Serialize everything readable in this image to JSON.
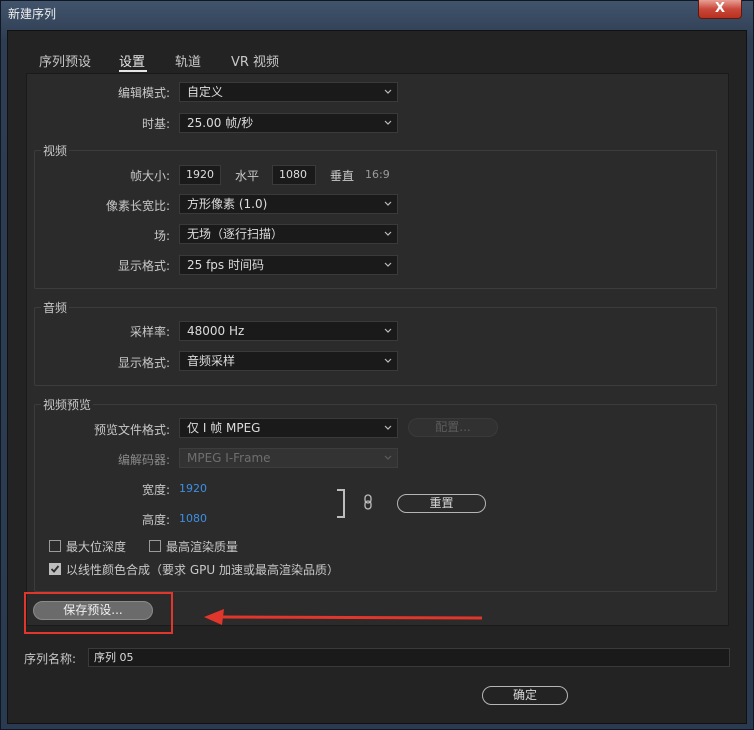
{
  "window": {
    "title": "新建序列",
    "close_label": "X"
  },
  "tabs": [
    {
      "label": "序列预设",
      "active": false
    },
    {
      "label": "设置",
      "active": true
    },
    {
      "label": "轨道",
      "active": false
    },
    {
      "label": "VR 视频",
      "active": false
    }
  ],
  "general": {
    "edit_mode_label": "编辑模式:",
    "edit_mode_value": "自定义",
    "timebase_label": "时基:",
    "timebase_value": "25.00  帧/秒"
  },
  "video": {
    "group_title": "视频",
    "frame_size_label": "帧大小:",
    "frame_width": "1920",
    "horizontal_label": "水平",
    "frame_height": "1080",
    "vertical_label": "垂直",
    "aspect_ratio": "16:9",
    "pixel_aspect_label": "像素长宽比:",
    "pixel_aspect_value": "方形像素 (1.0)",
    "fields_label": "场:",
    "fields_value": "无场（逐行扫描）",
    "display_format_label": "显示格式:",
    "display_format_value": "25 fps 时间码"
  },
  "audio": {
    "group_title": "音频",
    "sample_rate_label": "采样率:",
    "sample_rate_value": "48000 Hz",
    "display_format_label": "显示格式:",
    "display_format_value": "音频采样"
  },
  "preview": {
    "group_title": "视频预览",
    "file_format_label": "预览文件格式:",
    "file_format_value": "仅 I 帧 MPEG",
    "configure_label": "配置...",
    "codec_label": "编解码器:",
    "codec_value": "MPEG I-Frame",
    "width_label": "宽度:",
    "width_value": "1920",
    "height_label": "高度:",
    "height_value": "1080",
    "reset_label": "重置",
    "max_bit_depth_label": "最大位深度",
    "max_bit_depth_checked": false,
    "max_render_quality_label": "最高渲染质量",
    "max_render_quality_checked": false,
    "linear_color_label": "以线性颜色合成（要求 GPU 加速或最高渲染品质）",
    "linear_color_checked": true
  },
  "save_preset_label": "保存预设...",
  "sequence_name_label": "序列名称:",
  "sequence_name_value": "序列 05",
  "ok_label": "确定",
  "colors": {
    "accent_blue": "#3e8fe4",
    "highlight_red": "#e0362b"
  }
}
